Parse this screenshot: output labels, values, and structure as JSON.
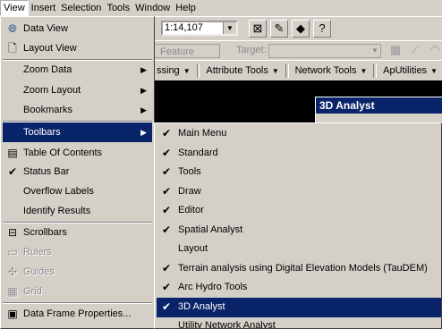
{
  "menubar": {
    "items": [
      "View",
      "Insert",
      "Selection",
      "Tools",
      "Window",
      "Help"
    ]
  },
  "toolbar": {
    "scale_value": "1:14,107",
    "feature_label": "Feature",
    "target_label": "Target:",
    "menus": [
      "ssing",
      "Attribute Tools",
      "Network Tools",
      "ApUtilities"
    ]
  },
  "analyst_window": {
    "title": "3D Analyst"
  },
  "view_menu": {
    "items": [
      {
        "label": "Data View",
        "icon": "data-view-icon"
      },
      {
        "label": "Layout View",
        "icon": "layout-view-icon"
      },
      {
        "label": "Zoom Data"
      },
      {
        "label": "Zoom Layout"
      },
      {
        "label": "Bookmarks"
      },
      {
        "label": "Toolbars"
      },
      {
        "label": "Table Of Contents",
        "icon": "table-of-contents-icon"
      },
      {
        "label": "Status Bar",
        "icon": "check-icon"
      },
      {
        "label": "Overflow Labels"
      },
      {
        "label": "Identify Results"
      },
      {
        "label": "Scrollbars",
        "icon": "scrollbars-icon"
      },
      {
        "label": "Rulers",
        "icon": "rulers-icon"
      },
      {
        "label": "Guides",
        "icon": "guides-icon"
      },
      {
        "label": "Grid",
        "icon": "grid-icon"
      },
      {
        "label": "Data Frame Properties...",
        "icon": "data-frame-properties-icon"
      }
    ]
  },
  "toolbars_menu": {
    "items": [
      {
        "label": "Main Menu",
        "checked": true
      },
      {
        "label": "Standard",
        "checked": true
      },
      {
        "label": "Tools",
        "checked": true
      },
      {
        "label": "Draw",
        "checked": true
      },
      {
        "label": "Editor",
        "checked": true
      },
      {
        "label": "Spatial Analyst",
        "checked": true
      },
      {
        "label": "Layout",
        "checked": false
      },
      {
        "label": "Terrain analysis using Digital Elevation Models (TauDEM)",
        "checked": true
      },
      {
        "label": "Arc Hydro Tools",
        "checked": true
      },
      {
        "label": "3D Analyst",
        "checked": true
      },
      {
        "label": "Utility Network Analyst",
        "checked": false
      }
    ]
  },
  "colors": {
    "highlight": "#0a246a",
    "face": "#d4d0c8",
    "map_background": "#000000"
  }
}
